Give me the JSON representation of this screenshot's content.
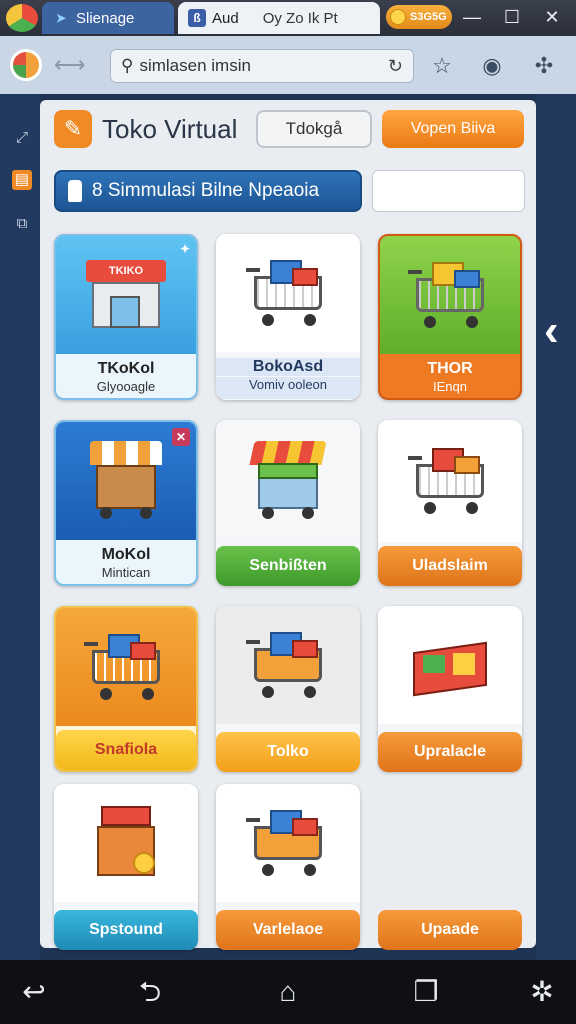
{
  "tabs": [
    {
      "label": "Slienage"
    },
    {
      "icon_text": "Aud",
      "label": "Oy Zo Ik Pt"
    }
  ],
  "coins": {
    "value": "S3G5G"
  },
  "address_bar": {
    "url": "simlasen imsin"
  },
  "header": {
    "title": "Toko Virtual",
    "toko_button": "Tdokgå",
    "beli_button": "Vopen Biiva"
  },
  "banner": {
    "label": "8 Simmulasi Bilne Npeaoia"
  },
  "cards": [
    {
      "title": "TKoKol",
      "sub": "Glyooagle"
    },
    {
      "title": "BokoAsd",
      "sub": "Vomiv ooleon"
    },
    {
      "title": "THOR",
      "sub": "IEnqn"
    },
    {
      "title": "MoKol",
      "sub": "Mintican"
    },
    {
      "label": "Senbißten"
    },
    {
      "label": "Uladslaim"
    },
    {
      "label": "Snafiola"
    },
    {
      "label": "Tolko"
    },
    {
      "label": "Upralacle"
    },
    {
      "label": "Spstound"
    },
    {
      "label": "Varlelaoe"
    },
    {
      "label": "Upaade"
    }
  ],
  "card_art_text": {
    "shop_sign": "TKIKO"
  },
  "icons": {
    "browser_logo": "browser-logo",
    "search": "search-icon",
    "refresh": "refresh-icon",
    "star": "star-icon",
    "profile": "profile-icon",
    "puzzle": "extensions-icon",
    "back_nav": "back-icon",
    "home_nav": "home-icon",
    "recent_nav": "recents-icon"
  },
  "colors": {
    "accent_orange": "#f08a24",
    "accent_blue": "#2e73b8",
    "accent_green": "#4caf50",
    "accent_yellow": "#f7c432",
    "accent_teal": "#2aa3c8"
  }
}
